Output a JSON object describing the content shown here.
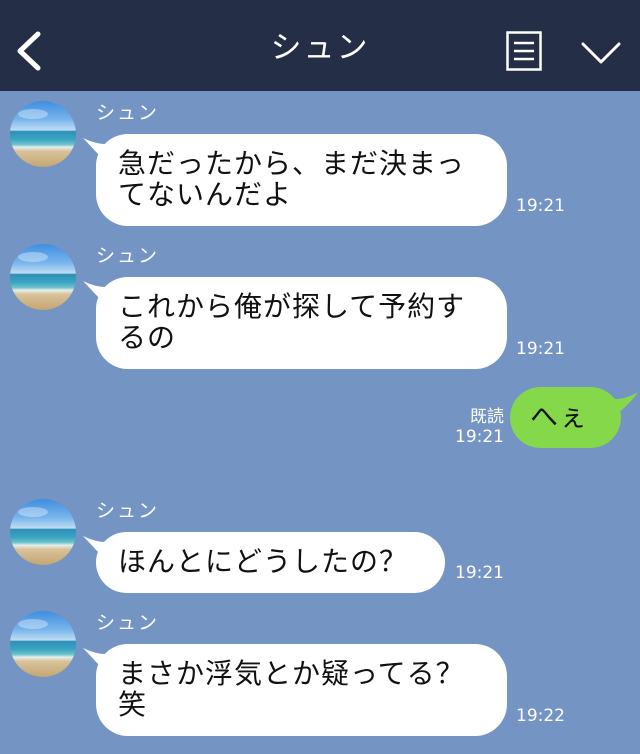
{
  "header": {
    "title": "シュン",
    "back_icon": "chevron-left-icon",
    "menu_icon": "list-icon",
    "expand_icon": "chevron-down-icon",
    "background": "#242e47"
  },
  "chat_background": "#7494c4",
  "messages": [
    {
      "sender": "シュン",
      "lines": [
        "急だったから、まだ決まっ",
        "てないんだよ"
      ],
      "time": "19:21"
    },
    {
      "sender": "シュン",
      "lines": [
        "これから俺が探して予約す",
        "るの"
      ],
      "time": "19:21"
    },
    {
      "text": "へぇ",
      "read": "既読",
      "time": "19:21"
    },
    {
      "sender": "シュン",
      "lines": [
        "ほんとにどうしたの？"
      ],
      "time": "19:21"
    },
    {
      "sender": "シュン",
      "lines": [
        "まさか浮気とか疑ってる？",
        "笑"
      ],
      "time": "19:22"
    }
  ],
  "colors": {
    "incoming_bubble": "#ffffff",
    "outgoing_bubble": "#86d84b"
  }
}
